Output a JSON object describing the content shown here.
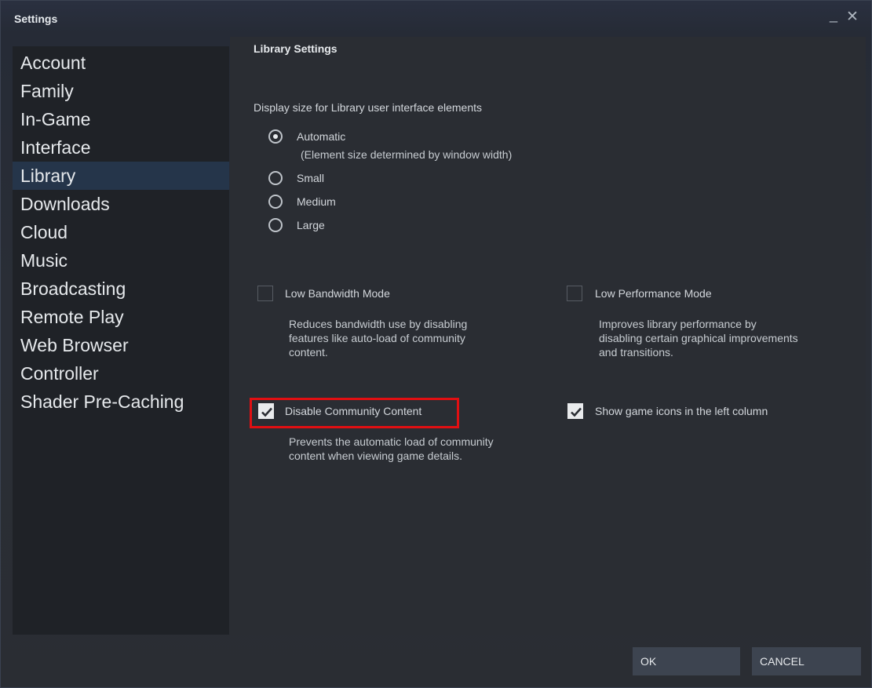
{
  "window": {
    "title": "Settings",
    "minimize_glyph": "_",
    "close_glyph": "✕"
  },
  "sidebar": {
    "items": [
      {
        "label": "Account"
      },
      {
        "label": "Family"
      },
      {
        "label": "In-Game"
      },
      {
        "label": "Interface"
      },
      {
        "label": "Library",
        "active": true
      },
      {
        "label": "Downloads"
      },
      {
        "label": "Cloud"
      },
      {
        "label": "Music"
      },
      {
        "label": "Broadcasting"
      },
      {
        "label": "Remote Play"
      },
      {
        "label": "Web Browser"
      },
      {
        "label": "Controller"
      },
      {
        "label": "Shader Pre-Caching"
      }
    ]
  },
  "library": {
    "heading": "Library Settings",
    "display_size_label": "Display size for Library user interface elements",
    "display_options": [
      {
        "label": "Automatic",
        "selected": true
      },
      {
        "label": "Small",
        "selected": false
      },
      {
        "label": "Medium",
        "selected": false
      },
      {
        "label": "Large",
        "selected": false
      }
    ],
    "automatic_note": "(Element size determined by window width)",
    "low_bandwidth": {
      "label": "Low Bandwidth Mode",
      "checked": false,
      "desc": [
        "Reduces bandwidth use by disabling",
        "features like auto-load of community",
        "content."
      ]
    },
    "low_performance": {
      "label": "Low Performance Mode",
      "checked": false,
      "desc": [
        "Improves library performance by",
        "disabling certain graphical improvements",
        "and transitions."
      ]
    },
    "disable_community": {
      "label": "Disable Community Content",
      "checked": true,
      "desc": [
        "Prevents the automatic load of community",
        "content when viewing game details."
      ]
    },
    "show_icons": {
      "label": "Show game icons in the left column",
      "checked": true
    }
  },
  "footer": {
    "ok_label": "OK",
    "cancel_label": "CANCEL"
  },
  "colors": {
    "active_nav": "#25354a",
    "highlight": "#e10f12",
    "button": "#3d4450"
  }
}
